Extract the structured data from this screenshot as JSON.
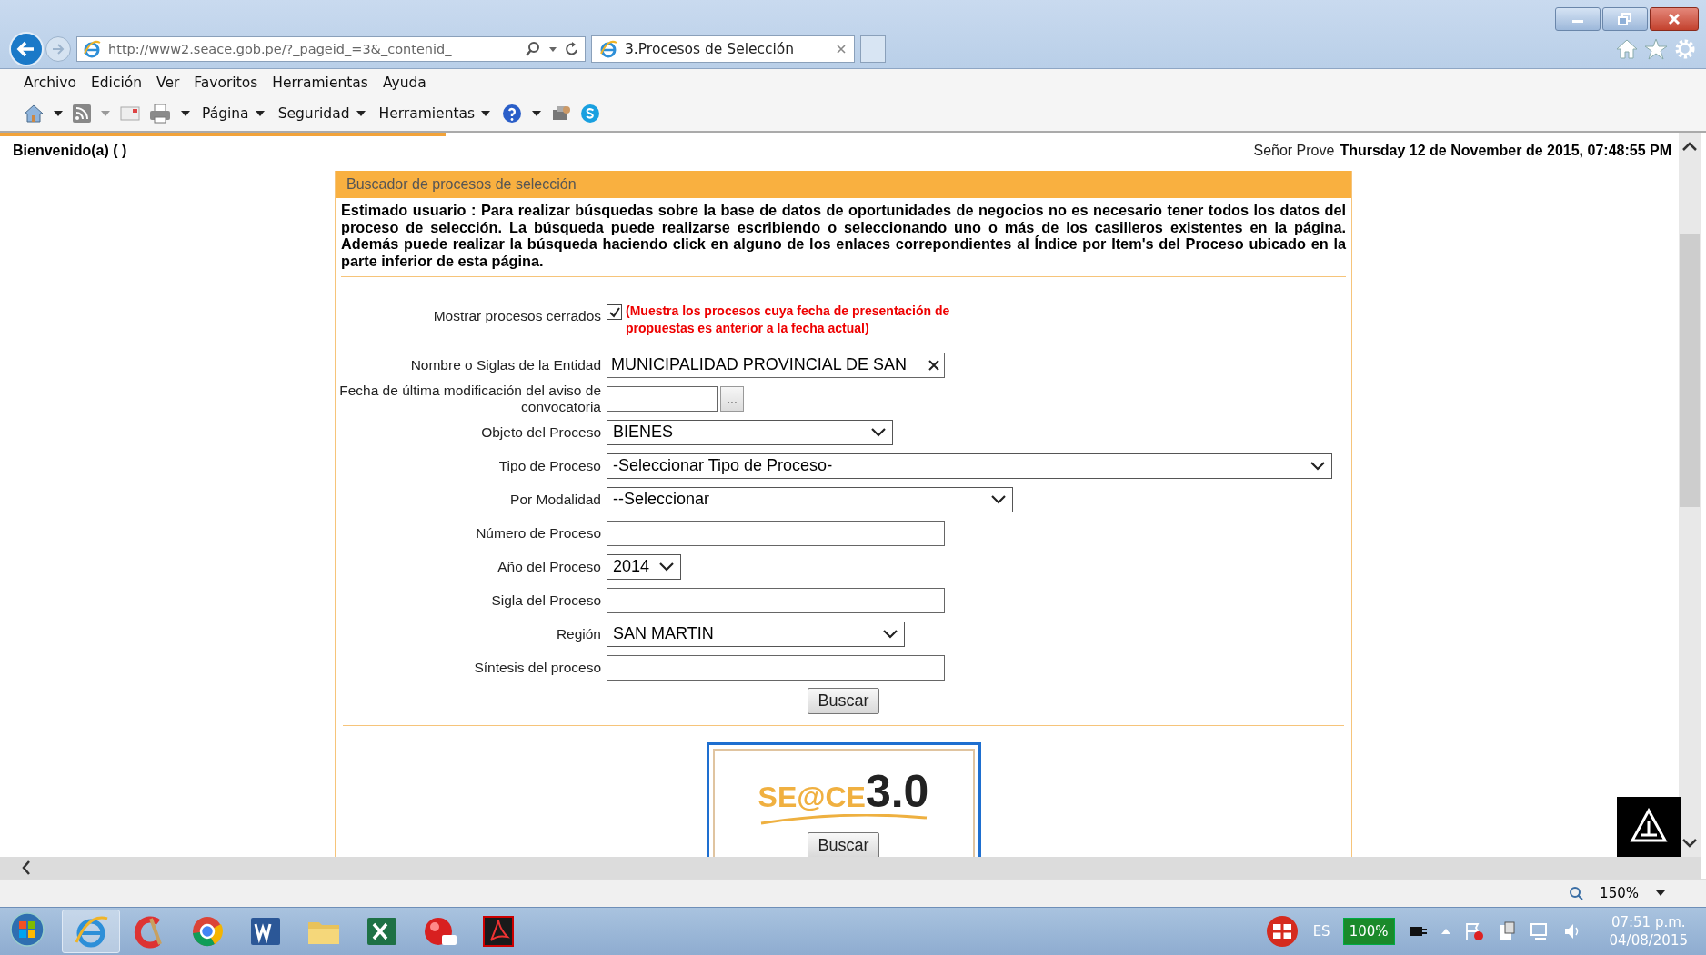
{
  "browser": {
    "address": "http://www2.seace.gob.pe/?_pageid_=3&_contenid_",
    "tab": {
      "title": "3.Procesos de Selección"
    }
  },
  "menu": [
    "Archivo",
    "Edición",
    "Ver",
    "Favoritos",
    "Herramientas",
    "Ayuda"
  ],
  "command_bar": [
    "Página",
    "Seguridad",
    "Herramientas"
  ],
  "page": {
    "welcome": "Bienvenido(a) ( )",
    "user_label": "Señor Prove",
    "datetime": "Thursday 12 de November de 2015, 07:48:55 PM"
  },
  "panel": {
    "title": "Buscador de procesos de selección",
    "notice": "Estimado usuario : Para realizar búsquedas sobre la base de datos de oportunidades de negocios no es necesario tener todos los datos del proceso de selección. La búsqueda puede realizarse escribiendo o seleccionando uno o más de los casilleros existentes en la página. Además puede realizar la búsqueda haciendo click en alguno de los enlaces correpondientes al Índice por Item's del Proceso ubicado en la parte inferior de esta página.",
    "fields": [
      {
        "kind": "checkbox",
        "label": "Mostrar procesos cerrados",
        "checked": true,
        "note": "(Muestra los procesos cuya fecha de presentación de propuestas es anterior a la fecha actual)"
      },
      {
        "kind": "text",
        "label": "Nombre o Siglas de la Entidad",
        "value": "MUNICIPALIDAD PROVINCIAL DE SAN",
        "clearable": true
      },
      {
        "kind": "date",
        "label": "Fecha de última modificación del aviso de convocatoria",
        "button": "..."
      },
      {
        "kind": "select",
        "label": "Objeto del Proceso",
        "value": "BIENES"
      },
      {
        "kind": "select",
        "label": "Tipo de Proceso",
        "value": "-Seleccionar Tipo de Proceso-"
      },
      {
        "kind": "select",
        "label": "Por Modalidad",
        "value": "--Seleccionar"
      },
      {
        "kind": "text",
        "label": "Número de Proceso"
      },
      {
        "kind": "select",
        "label": "Año del Proceso",
        "value": "2014"
      },
      {
        "kind": "text",
        "label": "Sigla del Proceso"
      },
      {
        "kind": "select",
        "label": "Región",
        "value": "SAN MARTIN"
      },
      {
        "kind": "text",
        "label": "Síntesis del proceso"
      }
    ],
    "search_button": "Buscar"
  },
  "logo": {
    "name": "SE@CE",
    "version": "3.0",
    "button": "Buscar"
  },
  "status_bar": {
    "zoom": "150%"
  },
  "taskbar": {
    "language": "ES",
    "battery": "100%",
    "time": "07:51 p.m.",
    "date": "04/08/2015"
  }
}
